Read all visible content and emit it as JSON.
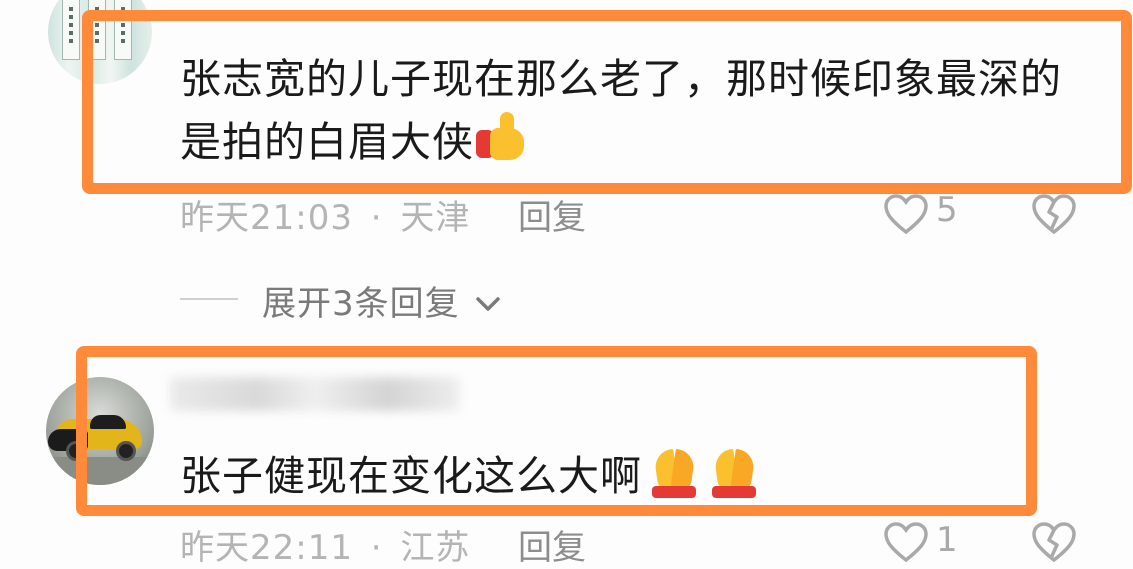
{
  "comments": [
    {
      "text": "张志宽的儿子现在那么老了，那时候印象最深的是拍的白眉大侠",
      "emoji": "thumbs-up",
      "time": "昨天21:03",
      "separator": "·",
      "location": "天津",
      "reply_label": "回复",
      "likes": "5"
    },
    {
      "text": "张子健现在变化这么大啊",
      "emoji": "folded-hands",
      "time": "昨天22:11",
      "separator": "·",
      "location": "江苏",
      "reply_label": "回复",
      "likes": "1"
    }
  ],
  "expand_replies": {
    "label": "展开3条回复",
    "icon": "chevron-down-icon"
  },
  "icons": {
    "like": "heart-outline-icon",
    "dislike": "broken-heart-icon"
  },
  "colors": {
    "highlight": "#ff8a3a",
    "meta_text": "#b4b4b4",
    "body_text": "#1a1a1a"
  }
}
